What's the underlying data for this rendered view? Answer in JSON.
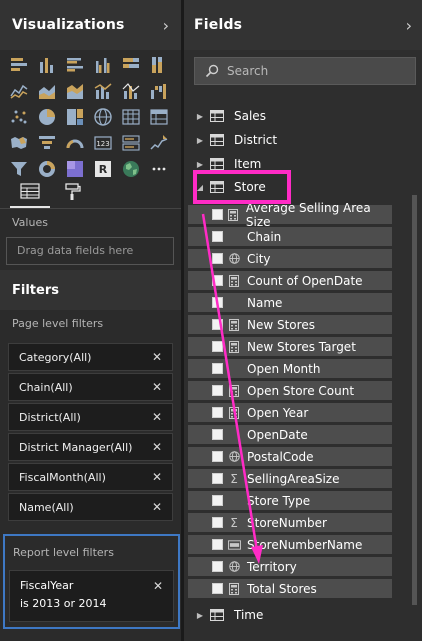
{
  "visualizations": {
    "title": "Visualizations",
    "chevron": "›",
    "icons": [
      "stacked-bar-icon",
      "stacked-column-icon",
      "clustered-bar-icon",
      "clustered-column-icon",
      "100-bar-icon",
      "100-column-icon",
      "line-chart-icon",
      "area-chart-icon",
      "stacked-area-icon",
      "line-column-icon",
      "line-stacked-column-icon",
      "waterfall-icon",
      "scatter-icon",
      "pie-chart-icon",
      "treemap-icon",
      "map-icon",
      "table-icon",
      "matrix-icon",
      "filled-map-icon",
      "funnel-icon",
      "gauge-icon",
      "card-icon",
      "multirow-card-icon",
      "kpi-icon",
      "slicer-icon",
      "donut-icon",
      "color-block-icon",
      "r-visual-icon",
      "globe-icon",
      "more-icon"
    ],
    "values_label": "Values",
    "values_placeholder": "Drag data fields here"
  },
  "filters": {
    "title": "Filters",
    "page_level_label": "Page level filters",
    "page_filters": [
      {
        "label": "Category(All)"
      },
      {
        "label": "Chain(All)"
      },
      {
        "label": "District(All)"
      },
      {
        "label": "District Manager(All)"
      },
      {
        "label": "FiscalMonth(All)"
      },
      {
        "label": "Name(All)"
      }
    ],
    "report_level_label": "Report level filters",
    "report_filter": {
      "line1": "FiscalYear",
      "line2": "is 2013 or 2014"
    },
    "close_glyph": "✕"
  },
  "fields": {
    "title": "Fields",
    "chevron": "›",
    "search_placeholder": "Search",
    "tables_top": [
      "Sales",
      "District",
      "Item"
    ],
    "store_table": "Store",
    "store_fields": [
      {
        "name": "Average Selling Area Size",
        "icon": "calc"
      },
      {
        "name": "Chain",
        "icon": "none"
      },
      {
        "name": "City",
        "icon": "globe"
      },
      {
        "name": "Count of OpenDate",
        "icon": "calc"
      },
      {
        "name": "Name",
        "icon": "none"
      },
      {
        "name": "New Stores",
        "icon": "calc"
      },
      {
        "name": "New Stores Target",
        "icon": "calc"
      },
      {
        "name": "Open Month",
        "icon": "none"
      },
      {
        "name": "Open Store Count",
        "icon": "calc"
      },
      {
        "name": "Open Year",
        "icon": "calc"
      },
      {
        "name": "OpenDate",
        "icon": "none"
      },
      {
        "name": "PostalCode",
        "icon": "globe"
      },
      {
        "name": "SellingAreaSize",
        "icon": "sigma"
      },
      {
        "name": "Store Type",
        "icon": "none"
      },
      {
        "name": "StoreNumber",
        "icon": "sigma"
      },
      {
        "name": "StoreNumberName",
        "icon": "card"
      },
      {
        "name": "Territory",
        "icon": "globe"
      },
      {
        "name": "Total Stores",
        "icon": "calc"
      }
    ],
    "tables_bottom": [
      "Time"
    ]
  },
  "colors": {
    "highlight": "#ff2bc6",
    "report_filter_border": "#3e78c4",
    "panel_bg": "#2b2b2b",
    "field_row_bg": "#4d4d4d"
  }
}
